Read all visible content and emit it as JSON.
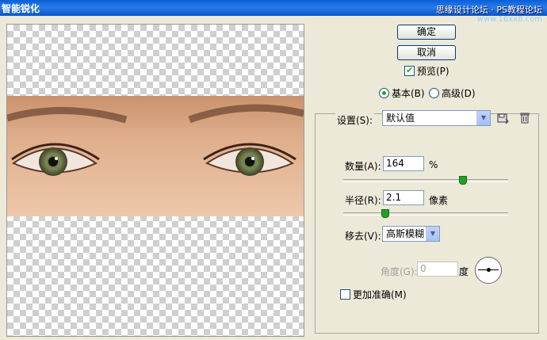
{
  "window": {
    "title": "智能锐化"
  },
  "watermark": {
    "text": "思缘设计论坛 · PS教程论坛",
    "sub": "www.16xx8.com"
  },
  "buttons": {
    "ok": "确定",
    "cancel": "取消"
  },
  "preview_checkbox": {
    "label": "预览(P)",
    "checked": true
  },
  "mode": {
    "basic": "基本(B)",
    "advanced": "高级(D)",
    "selected": "basic"
  },
  "settings": {
    "label": "设置(S):",
    "value": "默认值"
  },
  "amount": {
    "label": "数量(A):",
    "value": "164",
    "unit": "%",
    "slider_fraction": 0.72
  },
  "radius": {
    "label": "半径(R):",
    "value": "2.1",
    "unit": "像素",
    "slider_fraction": 0.25
  },
  "remove": {
    "label": "移去(V):",
    "value": "高斯模糊"
  },
  "angle": {
    "label": "角度(G):",
    "value": "0",
    "unit": "度"
  },
  "more_accurate": {
    "label": "更加准确(M)",
    "checked": false
  },
  "colors": {
    "title_bar": "#0a5fd8",
    "slider_thumb": "#21a121",
    "dialog_bg": "#ece9d8"
  }
}
